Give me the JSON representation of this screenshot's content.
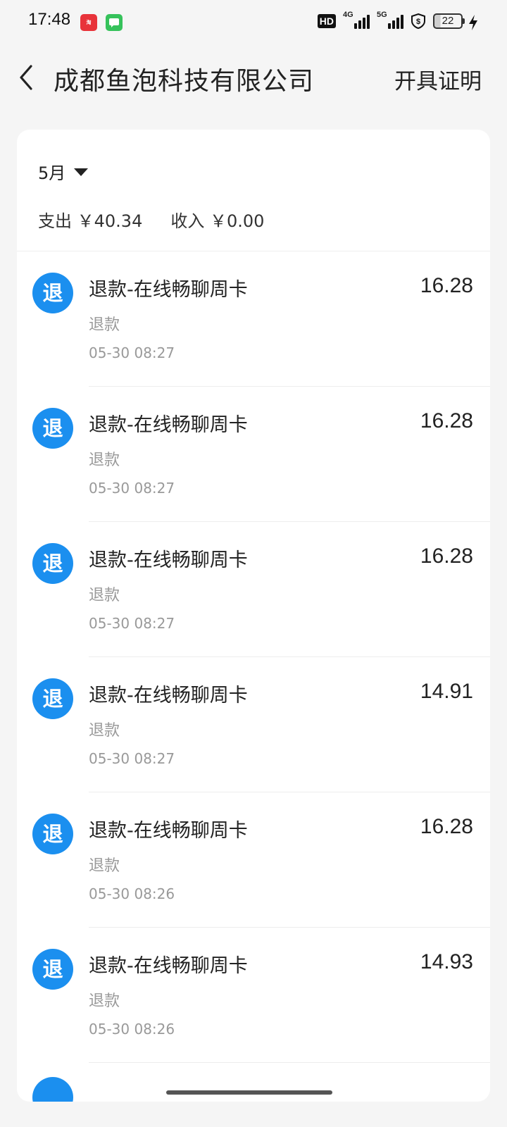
{
  "status_bar": {
    "time": "17:48",
    "hd": "HD",
    "net1": "4G",
    "net2": "5G",
    "battery": "22"
  },
  "header": {
    "title": "成都鱼泡科技有限公司",
    "action": "开具证明"
  },
  "filter": {
    "month": "5月"
  },
  "summary": {
    "expense": "支出 ￥40.34",
    "income": "收入 ￥0.00"
  },
  "transactions": [
    {
      "badge": "退",
      "title": "退款-在线畅聊周卡",
      "type": "退款",
      "time": "05-30 08:27",
      "amount": "16.28"
    },
    {
      "badge": "退",
      "title": "退款-在线畅聊周卡",
      "type": "退款",
      "time": "05-30 08:27",
      "amount": "16.28"
    },
    {
      "badge": "退",
      "title": "退款-在线畅聊周卡",
      "type": "退款",
      "time": "05-30 08:27",
      "amount": "16.28"
    },
    {
      "badge": "退",
      "title": "退款-在线畅聊周卡",
      "type": "退款",
      "time": "05-30 08:27",
      "amount": "14.91"
    },
    {
      "badge": "退",
      "title": "退款-在线畅聊周卡",
      "type": "退款",
      "time": "05-30 08:26",
      "amount": "16.28"
    },
    {
      "badge": "退",
      "title": "退款-在线畅聊周卡",
      "type": "退款",
      "time": "05-30 08:26",
      "amount": "14.93"
    }
  ],
  "colors": {
    "accent": "#1b8fef",
    "background": "#f5f5f5",
    "card": "#ffffff"
  }
}
